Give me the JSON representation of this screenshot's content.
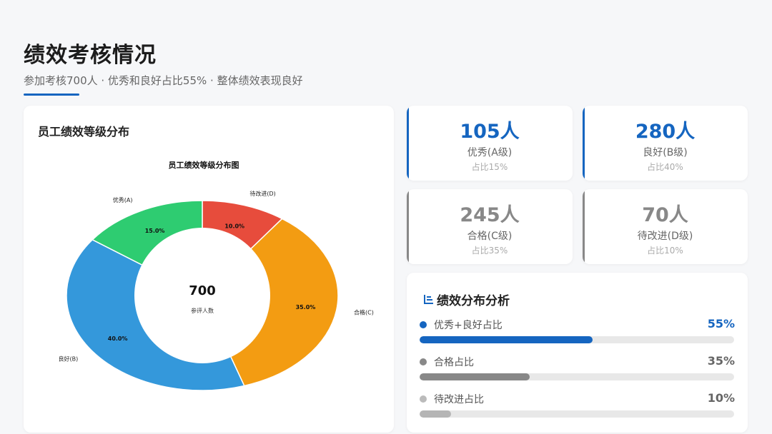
{
  "header": {
    "title": "绩效考核情况",
    "subtitle": "参加考核700人 · 优秀和良好占比55% · 整体绩效表现良好"
  },
  "chart_card": {
    "title": "员工绩效等级分布"
  },
  "chart_data": {
    "type": "pie",
    "title": "员工绩效等级分布图",
    "donut": true,
    "center_value": "700",
    "center_label": "参评人数",
    "slices": [
      {
        "label": "待改进(D)",
        "value": 10.0,
        "value_label": "10.0%",
        "color": "#e74c3c"
      },
      {
        "label": "合格(C)",
        "value": 35.0,
        "value_label": "35.0%",
        "color": "#f39c12"
      },
      {
        "label": "良好(B)",
        "value": 40.0,
        "value_label": "40.0%",
        "color": "#3498db"
      },
      {
        "label": "优秀(A)",
        "value": 15.0,
        "value_label": "15.0%",
        "color": "#2ecc71"
      }
    ]
  },
  "stats": [
    {
      "value": "105人",
      "label": "优秀(A级)",
      "share": "占比15%",
      "color": "#1565c0"
    },
    {
      "value": "280人",
      "label": "良好(B级)",
      "share": "占比40%",
      "color": "#1565c0"
    },
    {
      "value": "245人",
      "label": "合格(C级)",
      "share": "占比35%",
      "color": "#888888"
    },
    {
      "value": "70人",
      "label": "待改进(D级)",
      "share": "占比10%",
      "color": "#888888"
    }
  ],
  "analysis": {
    "title": "绩效分布分析",
    "icon": "bar-list-icon",
    "metrics": [
      {
        "label": "优秀+良好占比",
        "value": "55%",
        "fraction": 0.55,
        "color": "#1565c0",
        "dot_color": "#1565c0",
        "value_color": "#1565c0"
      },
      {
        "label": "合格占比",
        "value": "35%",
        "fraction": 0.35,
        "color": "#888888",
        "dot_color": "#888888",
        "value_color": "#666666"
      },
      {
        "label": "待改进占比",
        "value": "10%",
        "fraction": 0.1,
        "color": "#b5b5b5",
        "dot_color": "#bbbbbb",
        "value_color": "#666666"
      }
    ]
  }
}
